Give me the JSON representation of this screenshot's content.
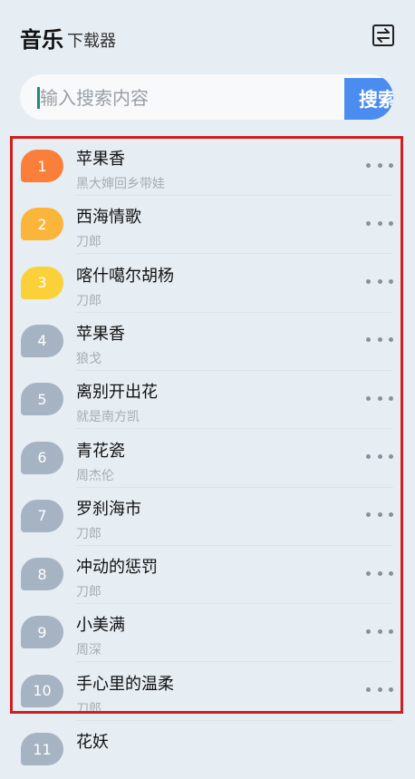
{
  "app": {
    "title_main": "音乐",
    "title_sub": "下载器",
    "header_icon": "switch-arrows-icon"
  },
  "search": {
    "placeholder": "输入搜索内容",
    "button_label": "搜索"
  },
  "colors": {
    "rank1": "#f97f3a",
    "rank2": "#fbb53a",
    "rank3": "#fbd13a",
    "rank_default": "#a6b3c3",
    "search_button": "#4a8cf0",
    "highlight_border": "#d01f1f"
  },
  "songs": [
    {
      "rank": "1",
      "title": "苹果香",
      "artist": "黑大婶回乡带娃"
    },
    {
      "rank": "2",
      "title": "西海情歌",
      "artist": "刀郎"
    },
    {
      "rank": "3",
      "title": "喀什噶尔胡杨",
      "artist": "刀郎"
    },
    {
      "rank": "4",
      "title": "苹果香",
      "artist": "狼戈"
    },
    {
      "rank": "5",
      "title": "离别开出花",
      "artist": "就是南方凯"
    },
    {
      "rank": "6",
      "title": "青花瓷",
      "artist": "周杰伦"
    },
    {
      "rank": "7",
      "title": "罗刹海市",
      "artist": "刀郎"
    },
    {
      "rank": "8",
      "title": "冲动的惩罚",
      "artist": "刀郎"
    },
    {
      "rank": "9",
      "title": "小美满",
      "artist": "周深"
    },
    {
      "rank": "10",
      "title": "手心里的温柔",
      "artist": "刀郎"
    },
    {
      "rank": "11",
      "title": "花妖",
      "artist": ""
    }
  ]
}
